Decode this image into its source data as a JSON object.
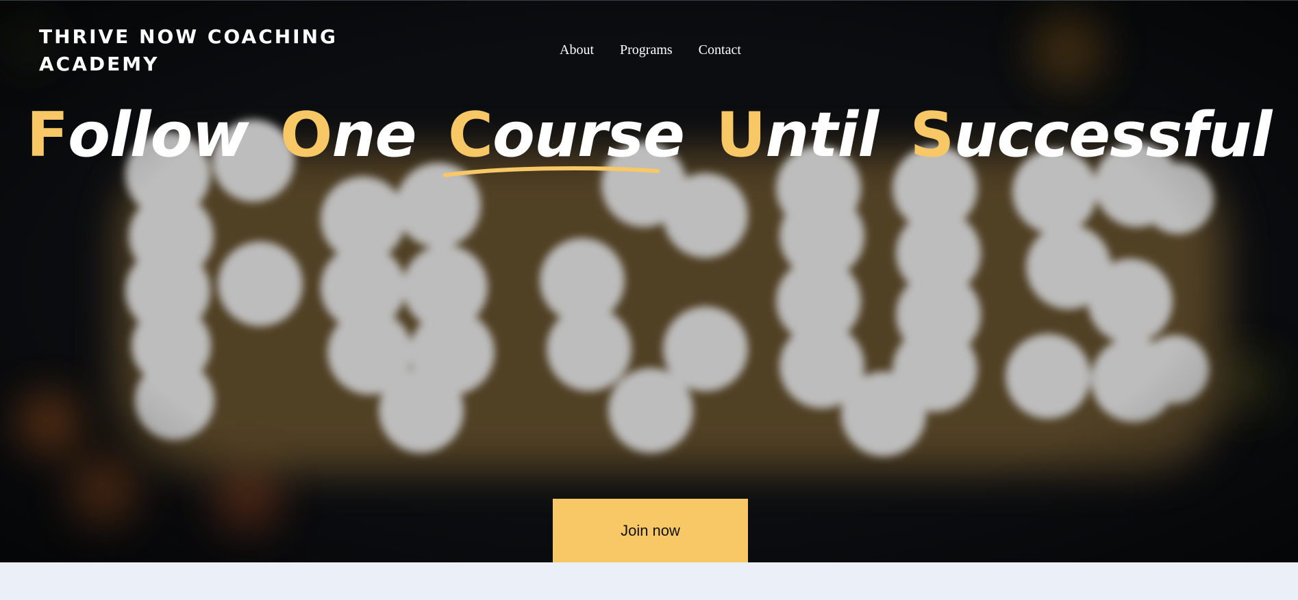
{
  "brand": {
    "name": "THRIVE NOW COACHING ACADEMY"
  },
  "nav": {
    "items": [
      {
        "label": "About"
      },
      {
        "label": "Programs"
      },
      {
        "label": "Contact"
      }
    ]
  },
  "hero": {
    "headline": {
      "words": [
        {
          "cap": "F",
          "rest": "ollow"
        },
        {
          "cap": "O",
          "rest": "ne"
        },
        {
          "cap": "C",
          "rest": "ourse"
        },
        {
          "cap": "U",
          "rest": "ntil"
        },
        {
          "cap": "S",
          "rest": "uccessful"
        }
      ]
    },
    "cta_label": "Join now"
  },
  "colors": {
    "accent": "#f8c766",
    "hero_dark": "#0b0d10",
    "page_bg": "#ebeff7",
    "bulb": "#bdbdbd"
  }
}
